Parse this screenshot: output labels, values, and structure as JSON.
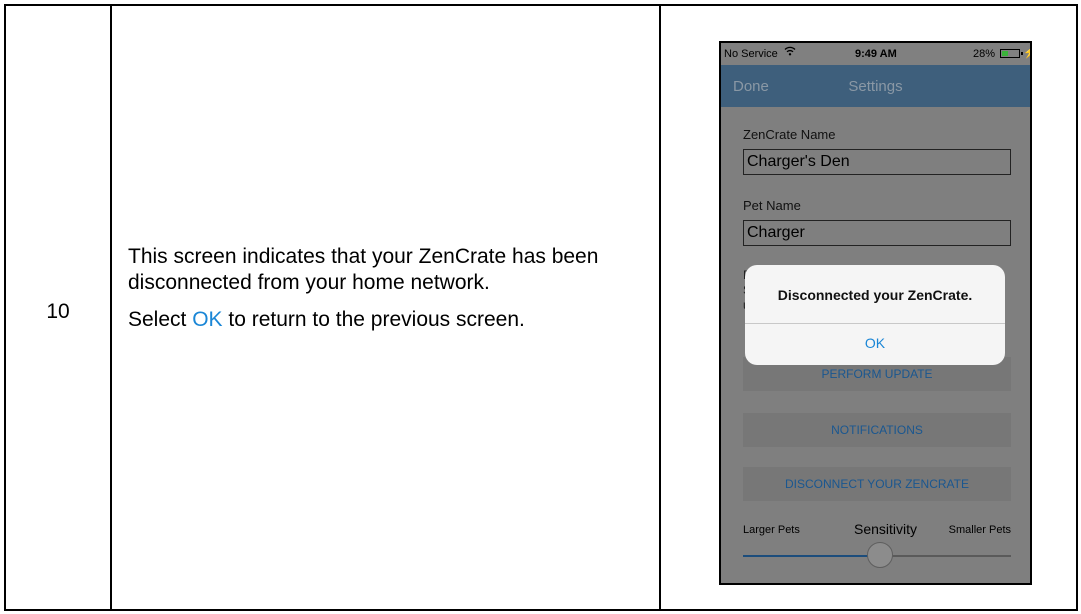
{
  "step": {
    "number": "10"
  },
  "description": {
    "line1": "This screen indicates that your ZenCrate has been disconnected from your home network.",
    "line2_prefix": "Select ",
    "line2_link": "OK",
    "line2_suffix": " to return to the previous screen."
  },
  "phone": {
    "status": {
      "carrier": "No Service",
      "time": "9:49 AM",
      "battery": "28%"
    },
    "nav": {
      "left_button": "Done",
      "title": "Settings"
    },
    "fields": [
      {
        "label": "ZenCrate Name",
        "value": "Charger's Den"
      },
      {
        "label": "Pet Name",
        "value": "Charger"
      }
    ],
    "obscured": {
      "a": "F",
      "b": "S",
      "c": "u"
    },
    "buttons": {
      "update": "PERFORM UPDATE",
      "notifications": "NOTIFICATIONS",
      "disconnect": "DISCONNECT YOUR ZENCRATE"
    },
    "slider": {
      "left_label": "Larger Pets",
      "center_label": "Sensitivity",
      "right_label": "Smaller Pets",
      "value_fraction": 0.51
    },
    "alert": {
      "message": "Disconnected your ZenCrate.",
      "button": "OK"
    }
  },
  "colors": {
    "link": "#1a86d6",
    "nav_bar": "#3e5f7c",
    "dim_overlay": "#7f7f7f"
  }
}
